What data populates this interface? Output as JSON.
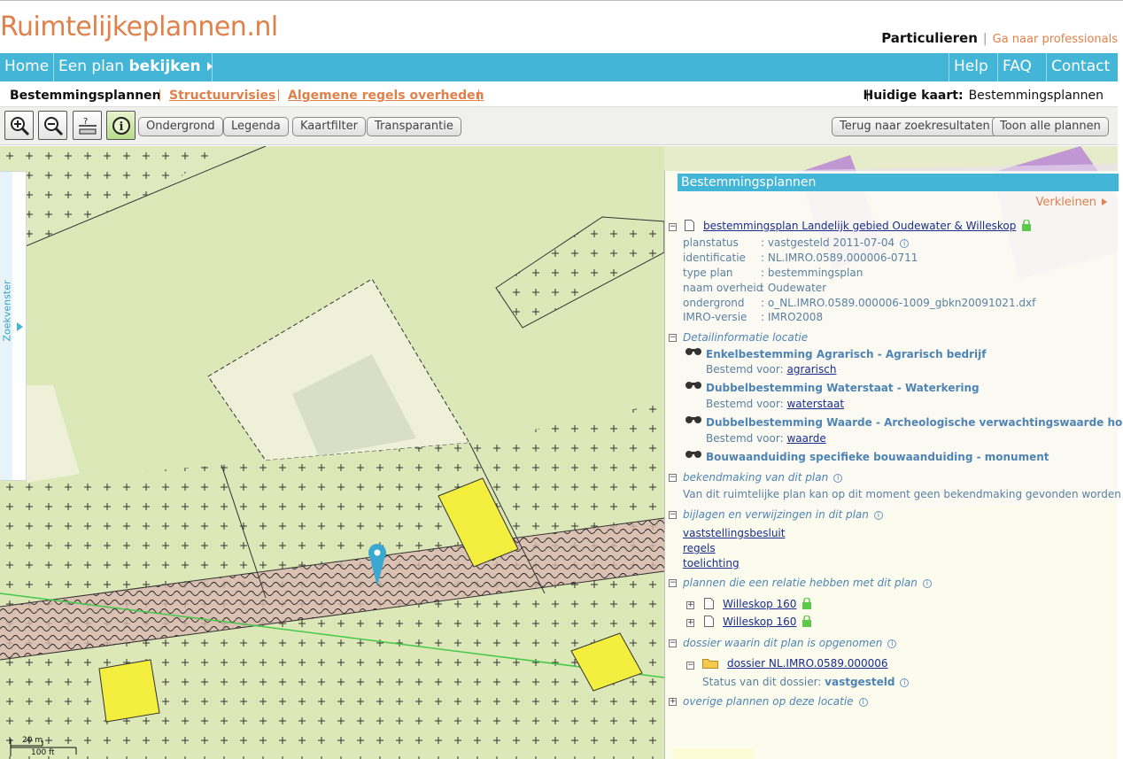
{
  "header": {
    "logo": "Ruimtelijkeplannen.nl",
    "audience_active": "Particulieren",
    "audience_separator": "|",
    "audience_other": "Ga naar professionals"
  },
  "mainnav": {
    "home": "Home",
    "plan_prefix": "Een plan",
    "plan_strong": "bekijken",
    "help": "Help",
    "faq": "FAQ",
    "contact": "Contact"
  },
  "tabs": {
    "items": [
      "Bestemmingsplannen",
      "Structuurvisies",
      "Algemene regels overheden"
    ],
    "current_label": "Huidige kaart:",
    "current_value": "Bestemmingsplannen"
  },
  "toolbar": {
    "buttons": [
      "zoom-in",
      "zoom-out",
      "measure",
      "info"
    ],
    "pills": [
      "Ondergrond",
      "Legenda",
      "Kaartfilter",
      "Transparantie"
    ],
    "right_pills": [
      "Terug naar zoekresultaten",
      "Toon alle plannen"
    ]
  },
  "zoekvenster": {
    "label": "Zoekvenster"
  },
  "panel": {
    "title": "Bestemmingsplannen",
    "collapse": "Verkleinen",
    "plan_link": "bestemmingsplan Landelijk gebied Oudewater & Willeskop",
    "props": [
      {
        "k": "planstatus",
        "v": ": vastgesteld 2011-07-04"
      },
      {
        "k": "identificatie",
        "v": ": NL.IMRO.0589.000006-0711"
      },
      {
        "k": "type plan",
        "v": ": bestemmingsplan"
      },
      {
        "k": "naam overheid",
        "v": ": Oudewater"
      },
      {
        "k": "ondergrond",
        "v": ": o_NL.IMRO.0589.000006-1009_gbkn20091021.dxf"
      },
      {
        "k": "IMRO-versie",
        "v": ": IMRO2008"
      }
    ],
    "detail_title": "Detailinformatie locatie",
    "details": [
      {
        "title": "Enkelbestemming Agrarisch - Agrarisch bedrijf",
        "label": "Bestemd voor:",
        "link": "agrarisch"
      },
      {
        "title": "Dubbelbestemming Waterstaat - Waterkering",
        "label": "Bestemd voor:",
        "link": "waterstaat"
      },
      {
        "title": "Dubbelbestemming Waarde - Archeologische verwachtingswaarde hoog",
        "label": "Bestemd voor:",
        "link": "waarde"
      },
      {
        "title": "Bouwaanduiding specifieke bouwaanduiding - monument",
        "label": "",
        "link": ""
      }
    ],
    "bekend_title": "bekendmaking van dit plan",
    "bekend_text": "Van dit ruimtelijke plan kan op dit moment geen bekendmaking gevonden worden",
    "bijlagen_title": "bijlagen en verwijzingen in dit plan",
    "bijlagen": [
      "vaststellingsbesluit",
      "regels",
      "toelichting"
    ],
    "relatie_title": "plannen die een relatie hebben met dit plan",
    "relaties": [
      "Willeskop 160",
      "Willeskop 160"
    ],
    "dossier_title": "dossier waarin dit plan is opgenomen",
    "dossier_link": "dossier NL.IMRO.0589.000006",
    "dossier_status_label": "Status van dit dossier:",
    "dossier_status_value": "vastgesteld",
    "overige_title": "overige plannen op deze locatie"
  },
  "scale": {
    "small": "20 m",
    "large": "100 ft"
  },
  "colors": {
    "accent": "#43b6d8",
    "brand_orange": "#e0804a",
    "map_green": "#dfe9bd",
    "building_yellow": "#f4ef3e",
    "purple": "#b882d6"
  }
}
